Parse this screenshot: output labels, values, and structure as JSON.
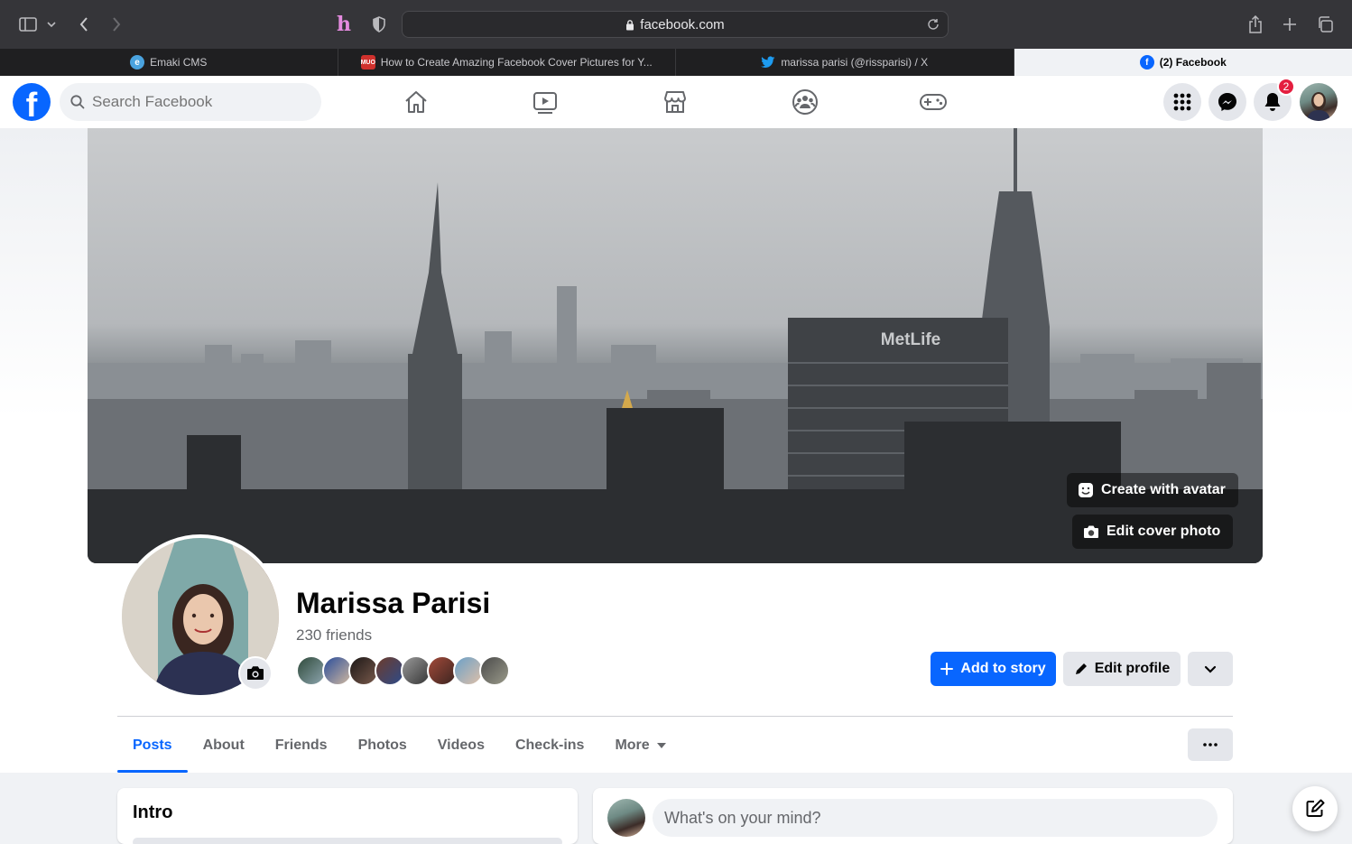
{
  "browser": {
    "url": "facebook.com",
    "tabs": [
      {
        "title": "Emaki CMS",
        "icon": "emaki-favicon",
        "active": false
      },
      {
        "title": "How to Create Amazing Facebook Cover Pictures for Y...",
        "icon": "muo-favicon",
        "active": false
      },
      {
        "title": "marissa parisi (@rissparisi) / X",
        "icon": "twitter-favicon",
        "active": false
      },
      {
        "title": "(2) Facebook",
        "icon": "facebook-favicon",
        "active": true
      }
    ]
  },
  "header": {
    "search_placeholder": "Search Facebook",
    "nav": [
      "home-icon",
      "watch-icon",
      "marketplace-icon",
      "groups-icon",
      "gaming-icon"
    ],
    "notification_count": "2",
    "brand_color": "#0866ff"
  },
  "cover": {
    "sign_text": "MetLife",
    "create_avatar_label": "Create with avatar",
    "edit_cover_label": "Edit cover photo"
  },
  "profile": {
    "name": "Marissa Parisi",
    "friends_text": "230 friends",
    "friend_avatar_count": 8,
    "add_story_label": "Add to story",
    "edit_profile_label": "Edit profile"
  },
  "tabs": [
    {
      "label": "Posts",
      "active": true
    },
    {
      "label": "About"
    },
    {
      "label": "Friends"
    },
    {
      "label": "Photos"
    },
    {
      "label": "Videos"
    },
    {
      "label": "Check-ins"
    },
    {
      "label": "More"
    }
  ],
  "intro": {
    "title": "Intro"
  },
  "composer": {
    "placeholder": "What's on your mind?"
  }
}
